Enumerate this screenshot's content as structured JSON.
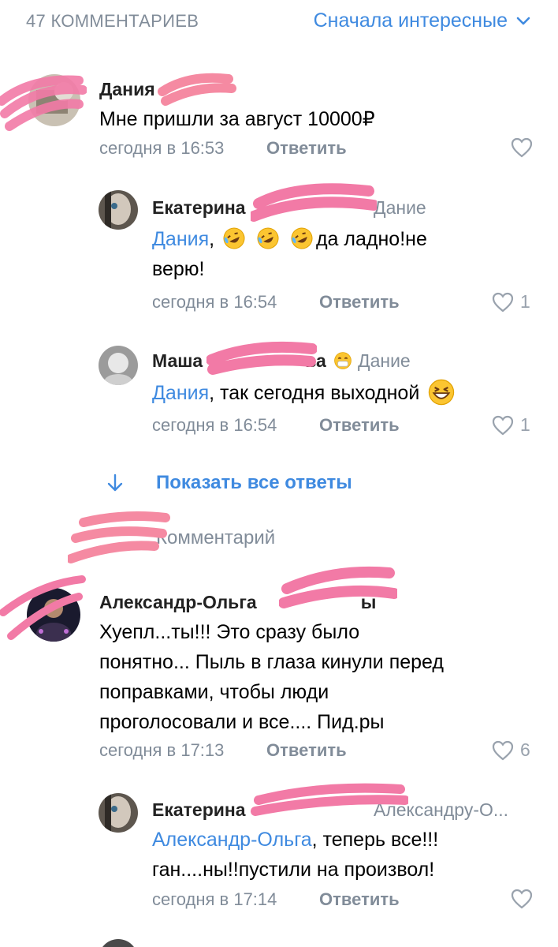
{
  "header": {
    "count_label": "47 КОММЕНТАРИЕВ",
    "sort_label": "Сначала интересные"
  },
  "comments": [
    {
      "author": "Дания",
      "text": "Мне пришли за август 10000₽",
      "time": "сегодня в 16:53",
      "reply_label": "Ответить",
      "likes": ""
    },
    {
      "author": "Екатерина",
      "reply_to": "Дание",
      "mention": "Дания",
      "text_after_emoji": "да ладно!не верю!",
      "time": "сегодня в 16:54",
      "reply_label": "Ответить",
      "likes": "1"
    },
    {
      "author": "Маша",
      "author_suffix": "ва",
      "reply_to": "Дание",
      "mention": "Дания",
      "text": ",  так сегодня выходной",
      "time": "сегодня в 16:54",
      "reply_label": "Ответить",
      "likes": "1"
    },
    {
      "author": "Александр-Ольга",
      "author_suffix": "ы",
      "text": "Хуепл...ты!!! Это сразу было понятно... Пыль в глаза кинули перед поправками, чтобы люди проголосовали и все.... Пид.ры",
      "time": "сегодня в 17:13",
      "reply_label": "Ответить",
      "likes": "6"
    },
    {
      "author": "Екатерина",
      "reply_to": "Александру-О...",
      "mention": "Александр-Ольга",
      "text": ", теперь все!!! ган....ны!!пустили на произвол!",
      "time": "сегодня в 17:14",
      "reply_label": "Ответить",
      "likes": ""
    }
  ],
  "show_all_replies": "Показать все ответы",
  "comment_input_placeholder": "Комментарий",
  "icons": {
    "sort": "chevron-down-icon",
    "like": "heart-outline-icon",
    "show_all": "arrow-down-icon",
    "emoji_laugh": "rolling-on-floor-laughing-emoji",
    "emoji_grin": "grinning-squinting-emoji",
    "emoji_mask": "smiling-face-emoji"
  },
  "colors": {
    "accent": "#3f8ae0",
    "secondary": "#818c99",
    "censor": "#f06aa0"
  }
}
